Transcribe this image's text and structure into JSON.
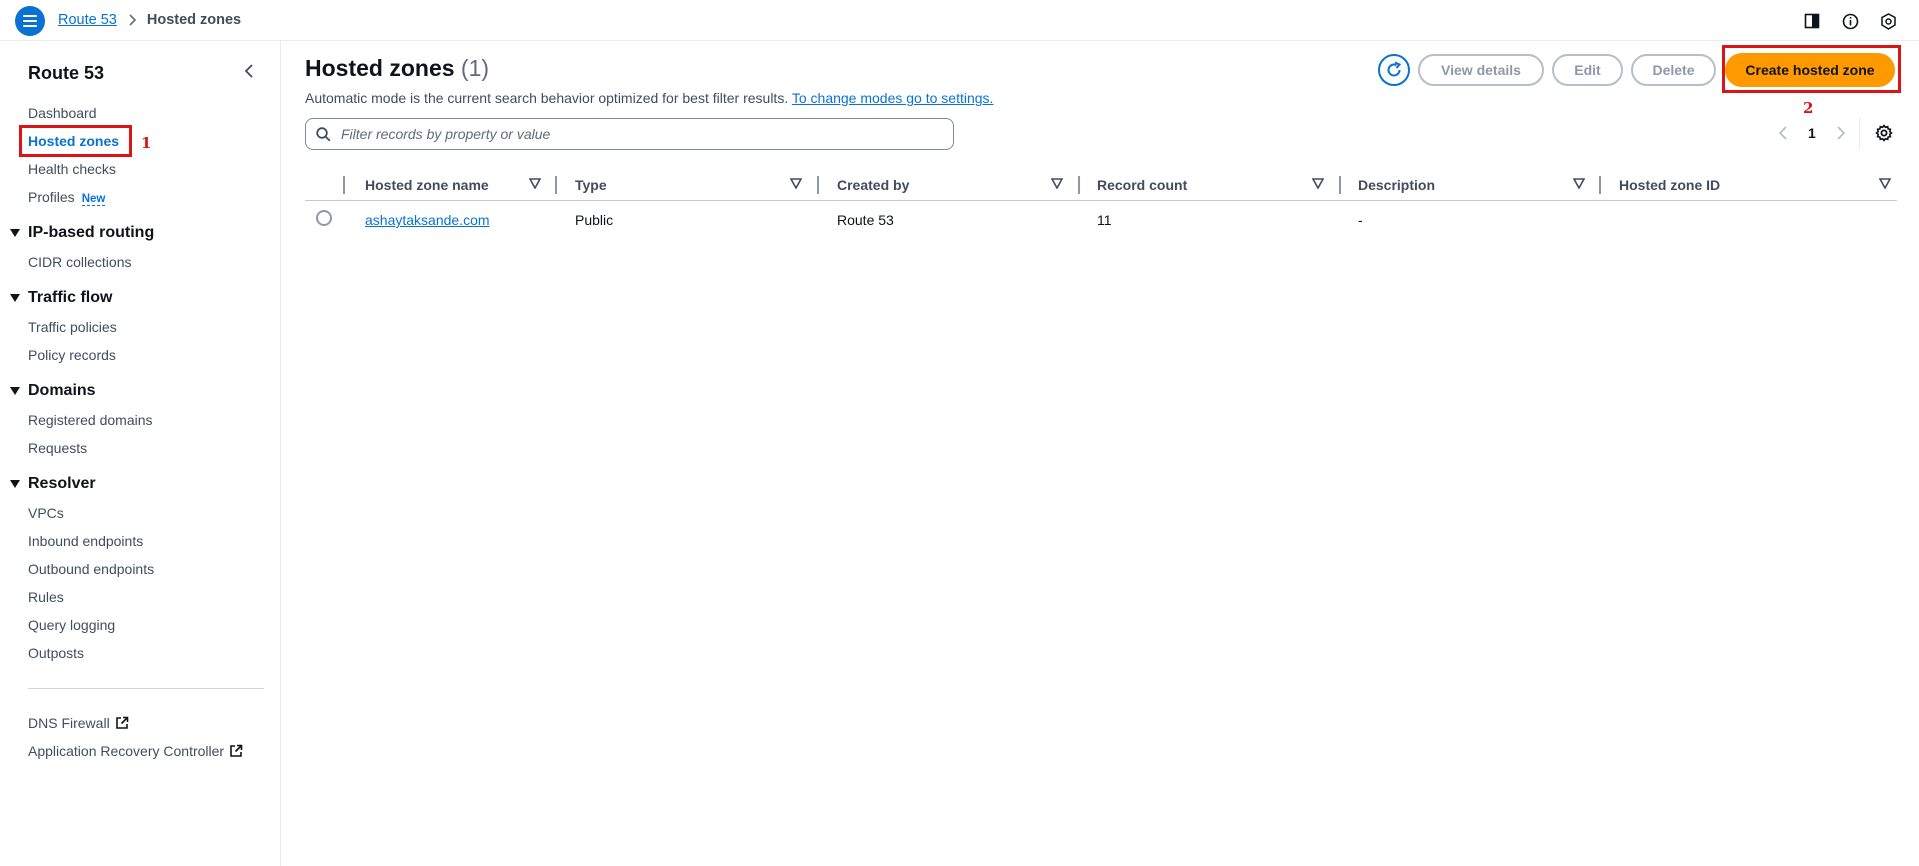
{
  "breadcrumb": {
    "root": "Route 53",
    "current": "Hosted zones"
  },
  "sidebar": {
    "title": "Route 53",
    "dashboard": "Dashboard",
    "hosted_zones": "Hosted zones",
    "health_checks": "Health checks",
    "profiles": "Profiles",
    "profiles_badge": "New",
    "sections": {
      "ip_routing": "IP-based routing",
      "traffic_flow": "Traffic flow",
      "domains": "Domains",
      "resolver": "Resolver"
    },
    "cidr_collections": "CIDR collections",
    "traffic_policies": "Traffic policies",
    "policy_records": "Policy records",
    "registered_domains": "Registered domains",
    "requests": "Requests",
    "vpcs": "VPCs",
    "inbound_endpoints": "Inbound endpoints",
    "outbound_endpoints": "Outbound endpoints",
    "rules": "Rules",
    "query_logging": "Query logging",
    "outposts": "Outposts",
    "dns_firewall": "DNS Firewall",
    "arc": "Application Recovery Controller"
  },
  "annotations": {
    "step1": "1",
    "step2": "2"
  },
  "main": {
    "title": "Hosted zones",
    "count": "(1)",
    "description": "Automatic mode is the current search behavior optimized for best filter results.",
    "description_link": "To change modes go to settings.",
    "buttons": {
      "view_details": "View details",
      "edit": "Edit",
      "delete": "Delete",
      "create": "Create hosted zone"
    },
    "search_placeholder": "Filter records by property or value",
    "page_number": "1"
  },
  "table": {
    "columns": [
      "Hosted zone name",
      "Type",
      "Created by",
      "Record count",
      "Description",
      "Hosted zone ID"
    ],
    "rows": [
      {
        "name": "ashaytaksande.com",
        "type": "Public",
        "created_by": "Route 53",
        "record_count": "11",
        "description": "-",
        "zone_id": ""
      }
    ]
  },
  "colors": {
    "accent": "#0972d3",
    "primary_button": "#ff9900",
    "annotation": "#d91515"
  }
}
